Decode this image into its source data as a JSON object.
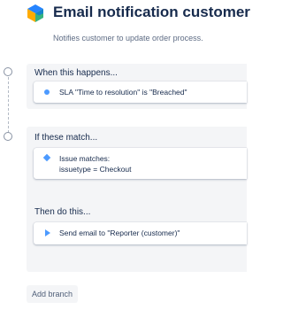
{
  "header": {
    "title": "Email notification customer",
    "subtitle": "Notifies customer to update order process.",
    "logo_icon": "automation-cube-icon"
  },
  "trigger": {
    "label": "When this happens...",
    "card_text": "SLA \"Time to resolution\" is \"Breached\"",
    "icon": "dot-icon"
  },
  "condition": {
    "label": "If these match...",
    "card_line1": "Issue matches:",
    "card_line2": "issuetype = Checkout",
    "icon": "diamond-icon"
  },
  "action": {
    "label": "Then do this...",
    "card_text": "Send email to \"Reporter (customer)\"",
    "icon": "play-icon"
  },
  "add_branch_label": "Add branch",
  "colors": {
    "accent": "#4c9aff",
    "panel": "#f4f5f7",
    "text": "#172b4d",
    "muted": "#5e6c84"
  }
}
